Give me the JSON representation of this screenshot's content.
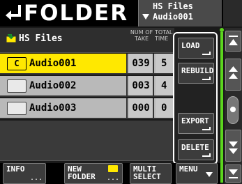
{
  "header": {
    "title": "FOLDER",
    "path_line1": "HS Files",
    "path_line2": "Audio001"
  },
  "list": {
    "parent_folder": "HS Files",
    "col_take": "NUM OF TAKE",
    "col_time": "TOTAL TIME",
    "rows": [
      {
        "icon_letter": "C",
        "name": "Audio001",
        "take": "039",
        "time": "5",
        "selected": true
      },
      {
        "icon_letter": "",
        "name": "Audio002",
        "take": "003",
        "time": "4",
        "selected": false
      },
      {
        "icon_letter": "",
        "name": "Audio003",
        "take": "000",
        "time": "0",
        "selected": false
      }
    ]
  },
  "popup_menu": {
    "load": "LOAD",
    "rebuild": "REBUILD",
    "export": "EXPORT",
    "delete": "DELETE"
  },
  "footer": {
    "info": "INFO",
    "info_dots": "...",
    "new_folder_line1": "NEW",
    "new_folder_line2": "FOLDER",
    "new_folder_dots": "...",
    "multi_line1": "MULTI",
    "multi_line2": "SELECT",
    "menu": "MENU"
  },
  "icons": {
    "back": "return-arrow-icon",
    "parent": "parent-folder-icon",
    "folder": "folder-icon",
    "scroll_top": "scroll-top-icon",
    "scroll_up": "scroll-up-icon",
    "scroll_down": "scroll-down-icon",
    "scroll_bottom": "scroll-bottom-icon"
  },
  "colors": {
    "selected_row": "#ffe800",
    "level_meter": "#5cd61e",
    "row_bg": "#b9b9b9"
  }
}
